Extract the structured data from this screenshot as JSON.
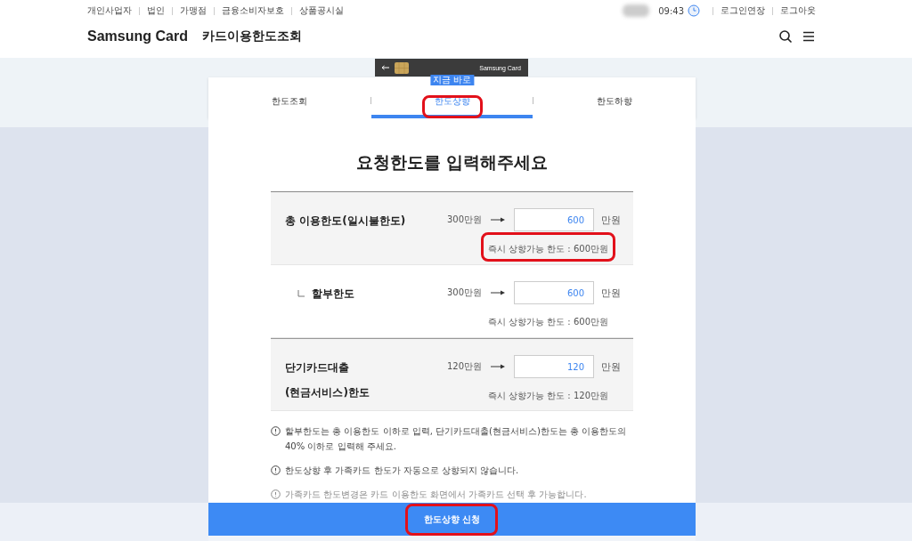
{
  "top_links": [
    "개인사업자",
    "법인",
    "가맹점",
    "금융소비자보호",
    "상품공시실"
  ],
  "session": {
    "time": "09:43",
    "links": [
      "로그인연장",
      "로그아웃"
    ]
  },
  "header": {
    "brand": "Samsung Card",
    "title": "카드이용한도조회"
  },
  "card": {
    "label": "Samsung Card"
  },
  "tabs": [
    {
      "label": "한도조회",
      "selected": false,
      "highlighted": false
    },
    {
      "label": "한도상향",
      "selected": true,
      "highlighted": true,
      "badge": "지금 바로"
    },
    {
      "label": "한도하향",
      "selected": false,
      "highlighted": false
    }
  ],
  "heading": "요청한도를 입력해주세요",
  "rows": [
    {
      "label": "총 이용한도(일시불한도)",
      "sub": false,
      "shaded": true,
      "current": "300만원",
      "value": "600",
      "unit": "만원",
      "hint": "즉시 상향가능 한도 : 600만원",
      "highlighted": true
    },
    {
      "label": "할부한도",
      "sub": true,
      "shaded": false,
      "current": "300만원",
      "value": "600",
      "unit": "만원",
      "hint": "즉시 상향가능 한도 : 600만원",
      "highlighted": false
    },
    {
      "label": "단기카드대출\n(현금서비스)한도",
      "sub": false,
      "shaded": true,
      "current": "120만원",
      "value": "120",
      "unit": "만원",
      "hint": "즉시 상향가능 한도 : 120만원",
      "highlighted": false
    }
  ],
  "notes": [
    {
      "text": "할부한도는 총 이용한도 이하로 입력, 단기카드대출(현금서비스)한도는 총 이용한도의 40% 이하로 입력해 주세요.",
      "faded": false
    },
    {
      "text": "한도상향 후 가족카드 한도가 자동으로 상향되지 않습니다.",
      "faded": false
    },
    {
      "text": "가족카드 한도변경은 카드 이용한도 화면에서 가족카드 선택 후 가능합니다.",
      "faded": true
    }
  ],
  "submit": {
    "label": "한도상향 신청",
    "highlighted": true
  }
}
